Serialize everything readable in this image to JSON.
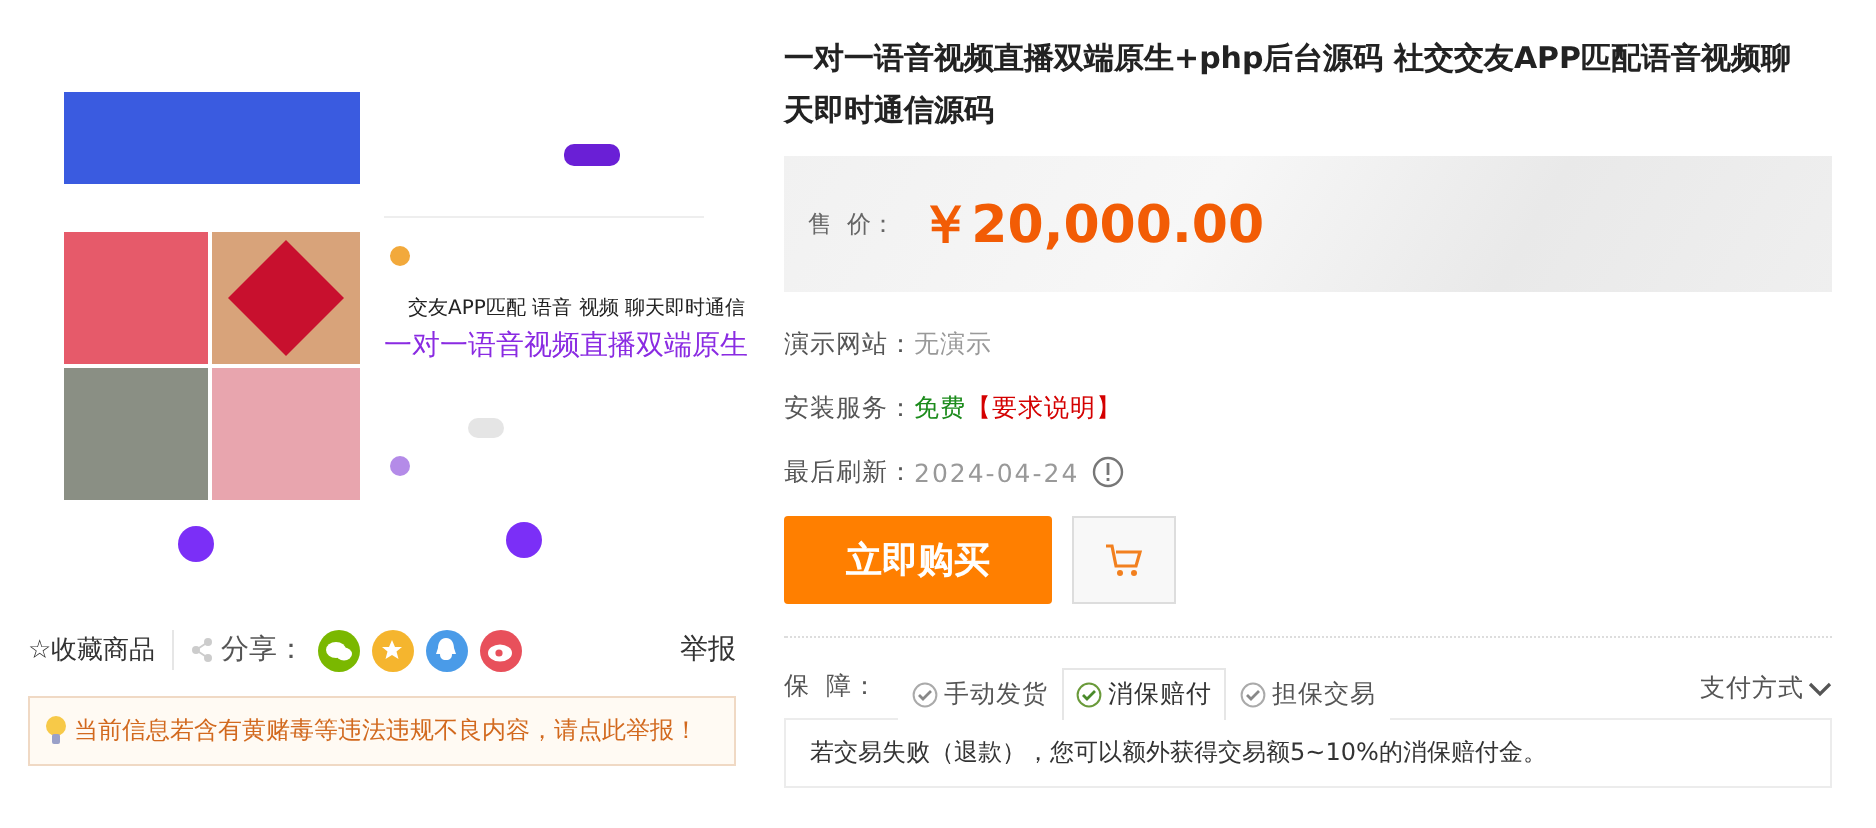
{
  "product_image": {
    "kind": "picture",
    "captions": [
      "交友APP匹配 语音 视频 聊天即时通信",
      "一对一语音视频直播双端原生"
    ]
  },
  "actions": {
    "favorite": "☆收藏商品",
    "share_label": "分享：",
    "share_targets": [
      {
        "kind": "wechat",
        "color": "#7ab800"
      },
      {
        "kind": "star",
        "color": "#f5b52e"
      },
      {
        "kind": "qq",
        "color": "#4a9be8"
      },
      {
        "kind": "weibo",
        "color": "#e8505b"
      }
    ],
    "report": "举报"
  },
  "notice": "当前信息若含有黄赌毒等违法违规不良内容，请点此举报！",
  "title": "一对一语音视频直播双端原生+php后台源码 社交交友APP匹配语音视频聊天即时通信源码",
  "price": {
    "label": "售  价：",
    "value": "￥20,000.00"
  },
  "details": [
    {
      "label": "演示网站：",
      "value": "无演示",
      "kind": "plain"
    },
    {
      "label": "安装服务：",
      "value": "免费",
      "extra": "【要求说明】",
      "kind": "service"
    },
    {
      "label": "最后刷新：",
      "value": "2024-04-24",
      "kind": "date"
    }
  ],
  "buy_button": "立即购买",
  "guarantee": {
    "label": "保  障：",
    "tabs": [
      {
        "label": "手动发货",
        "selected": false
      },
      {
        "label": "消保赔付",
        "selected": true
      },
      {
        "label": "担保交易",
        "selected": false
      }
    ],
    "payment": "支付方式",
    "content": "若交易失败（退款），您可以额外获得交易额5~10%的消保赔付金。"
  }
}
